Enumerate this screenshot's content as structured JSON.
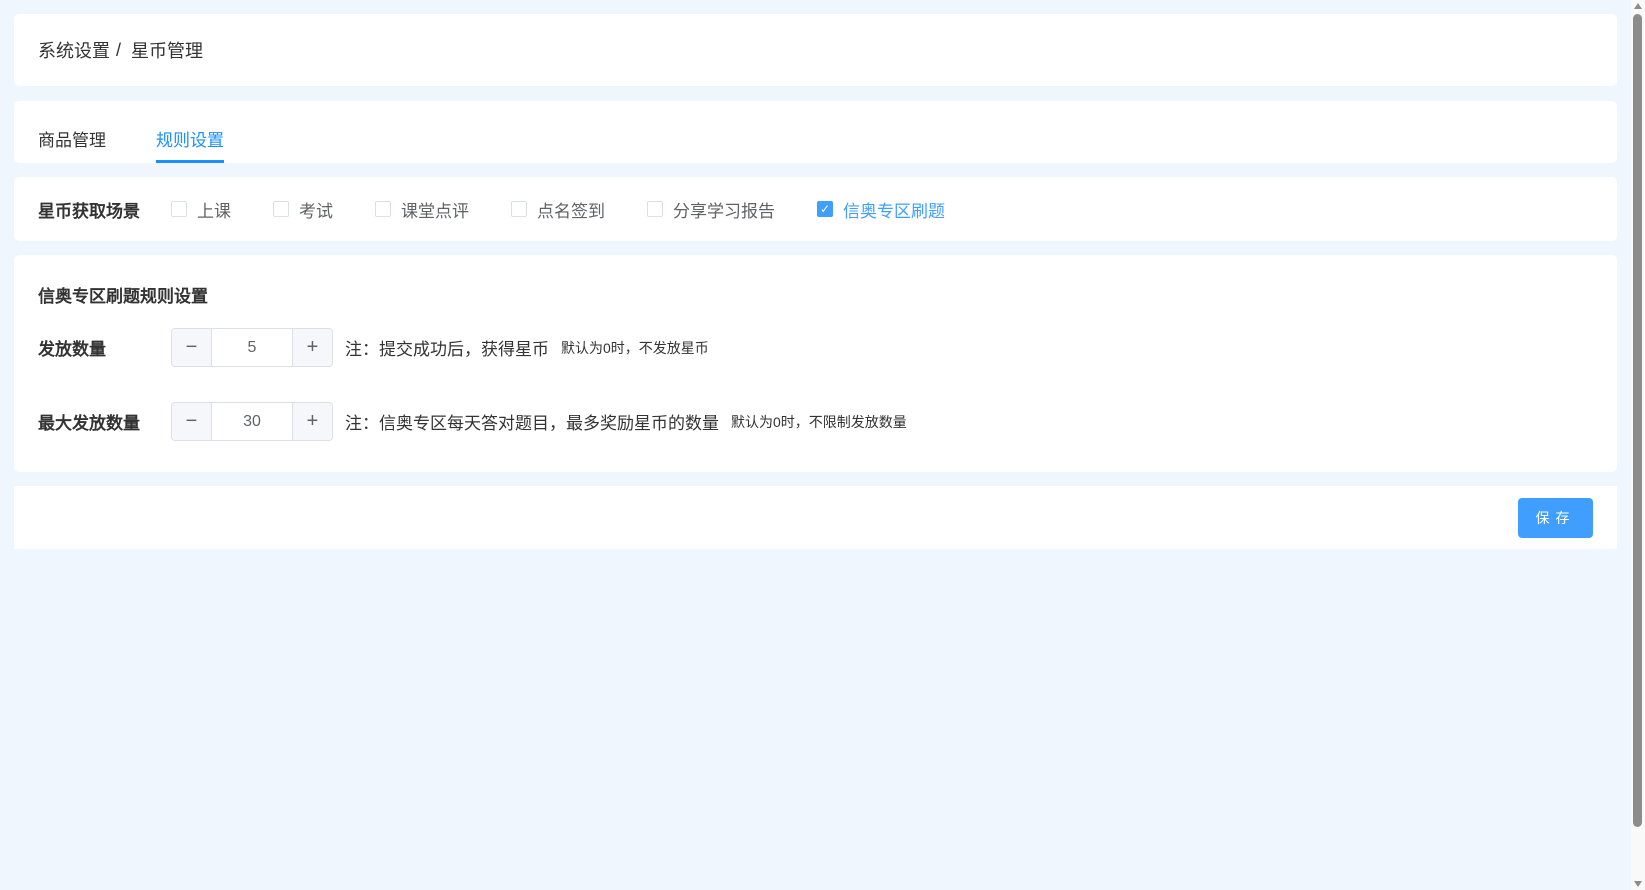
{
  "breadcrumb": {
    "parent": "系统设置",
    "separator": "/",
    "current": "星币管理"
  },
  "tabs": [
    {
      "label": "商品管理",
      "active": false
    },
    {
      "label": "规则设置",
      "active": true
    }
  ],
  "scenes": {
    "label": "星币获取场景",
    "options": [
      {
        "label": "上课",
        "checked": false
      },
      {
        "label": "考试",
        "checked": false
      },
      {
        "label": "课堂点评",
        "checked": false
      },
      {
        "label": "点名签到",
        "checked": false
      },
      {
        "label": "分享学习报告",
        "checked": false
      },
      {
        "label": "信奥专区刷题",
        "checked": true
      }
    ]
  },
  "rules": {
    "title": "信奥专区刷题规则设置",
    "issue": {
      "label": "发放数量",
      "value": "5",
      "note": "注：提交成功后，获得星币",
      "hint": "默认为0时，不发放星币"
    },
    "max": {
      "label": "最大发放数量",
      "value": "30",
      "note": "注：信奥专区每天答对题目，最多奖励星币的数量",
      "hint": "默认为0时，不限制发放数量"
    },
    "minus": "−",
    "plus": "+"
  },
  "footer": {
    "save_label": "保存"
  },
  "colors": {
    "accent": "#409eff",
    "tab_active": "#1890ff",
    "background": "#eff6fe"
  }
}
